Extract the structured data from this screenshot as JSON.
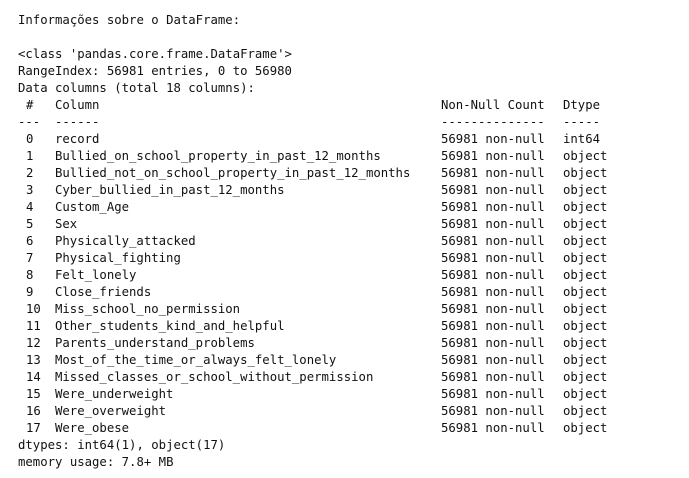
{
  "heading": "Informações sobre o DataFrame:",
  "class_line": "<class 'pandas.core.frame.DataFrame'>",
  "range_index": "RangeIndex: 56981 entries, 0 to 56980",
  "data_columns": "Data columns (total 18 columns):",
  "header": {
    "num": "#",
    "column": "Column",
    "count": "Non-Null Count",
    "dtype": "Dtype"
  },
  "separator": {
    "num": "---",
    "column": "------",
    "count": "--------------",
    "dtype": "-----"
  },
  "rows": [
    {
      "num": "0",
      "column": "record",
      "count": "56981 non-null",
      "dtype": "int64"
    },
    {
      "num": "1",
      "column": "Bullied_on_school_property_in_past_12_months",
      "count": "56981 non-null",
      "dtype": "object"
    },
    {
      "num": "2",
      "column": "Bullied_not_on_school_property_in_past_12_months",
      "count": "56981 non-null",
      "dtype": "object"
    },
    {
      "num": "3",
      "column": "Cyber_bullied_in_past_12_months",
      "count": "56981 non-null",
      "dtype": "object"
    },
    {
      "num": "4",
      "column": "Custom_Age",
      "count": "56981 non-null",
      "dtype": "object"
    },
    {
      "num": "5",
      "column": "Sex",
      "count": "56981 non-null",
      "dtype": "object"
    },
    {
      "num": "6",
      "column": "Physically_attacked",
      "count": "56981 non-null",
      "dtype": "object"
    },
    {
      "num": "7",
      "column": "Physical_fighting",
      "count": "56981 non-null",
      "dtype": "object"
    },
    {
      "num": "8",
      "column": "Felt_lonely",
      "count": "56981 non-null",
      "dtype": "object"
    },
    {
      "num": "9",
      "column": "Close_friends",
      "count": "56981 non-null",
      "dtype": "object"
    },
    {
      "num": "10",
      "column": "Miss_school_no_permission",
      "count": "56981 non-null",
      "dtype": "object"
    },
    {
      "num": "11",
      "column": "Other_students_kind_and_helpful",
      "count": "56981 non-null",
      "dtype": "object"
    },
    {
      "num": "12",
      "column": "Parents_understand_problems",
      "count": "56981 non-null",
      "dtype": "object"
    },
    {
      "num": "13",
      "column": "Most_of_the_time_or_always_felt_lonely",
      "count": "56981 non-null",
      "dtype": "object"
    },
    {
      "num": "14",
      "column": "Missed_classes_or_school_without_permission",
      "count": "56981 non-null",
      "dtype": "object"
    },
    {
      "num": "15",
      "column": "Were_underweight",
      "count": "56981 non-null",
      "dtype": "object"
    },
    {
      "num": "16",
      "column": "Were_overweight",
      "count": "56981 non-null",
      "dtype": "object"
    },
    {
      "num": "17",
      "column": "Were_obese",
      "count": "56981 non-null",
      "dtype": "object"
    }
  ],
  "dtypes_line": "dtypes: int64(1), object(17)",
  "memory_line": "memory usage: 7.8+ MB"
}
